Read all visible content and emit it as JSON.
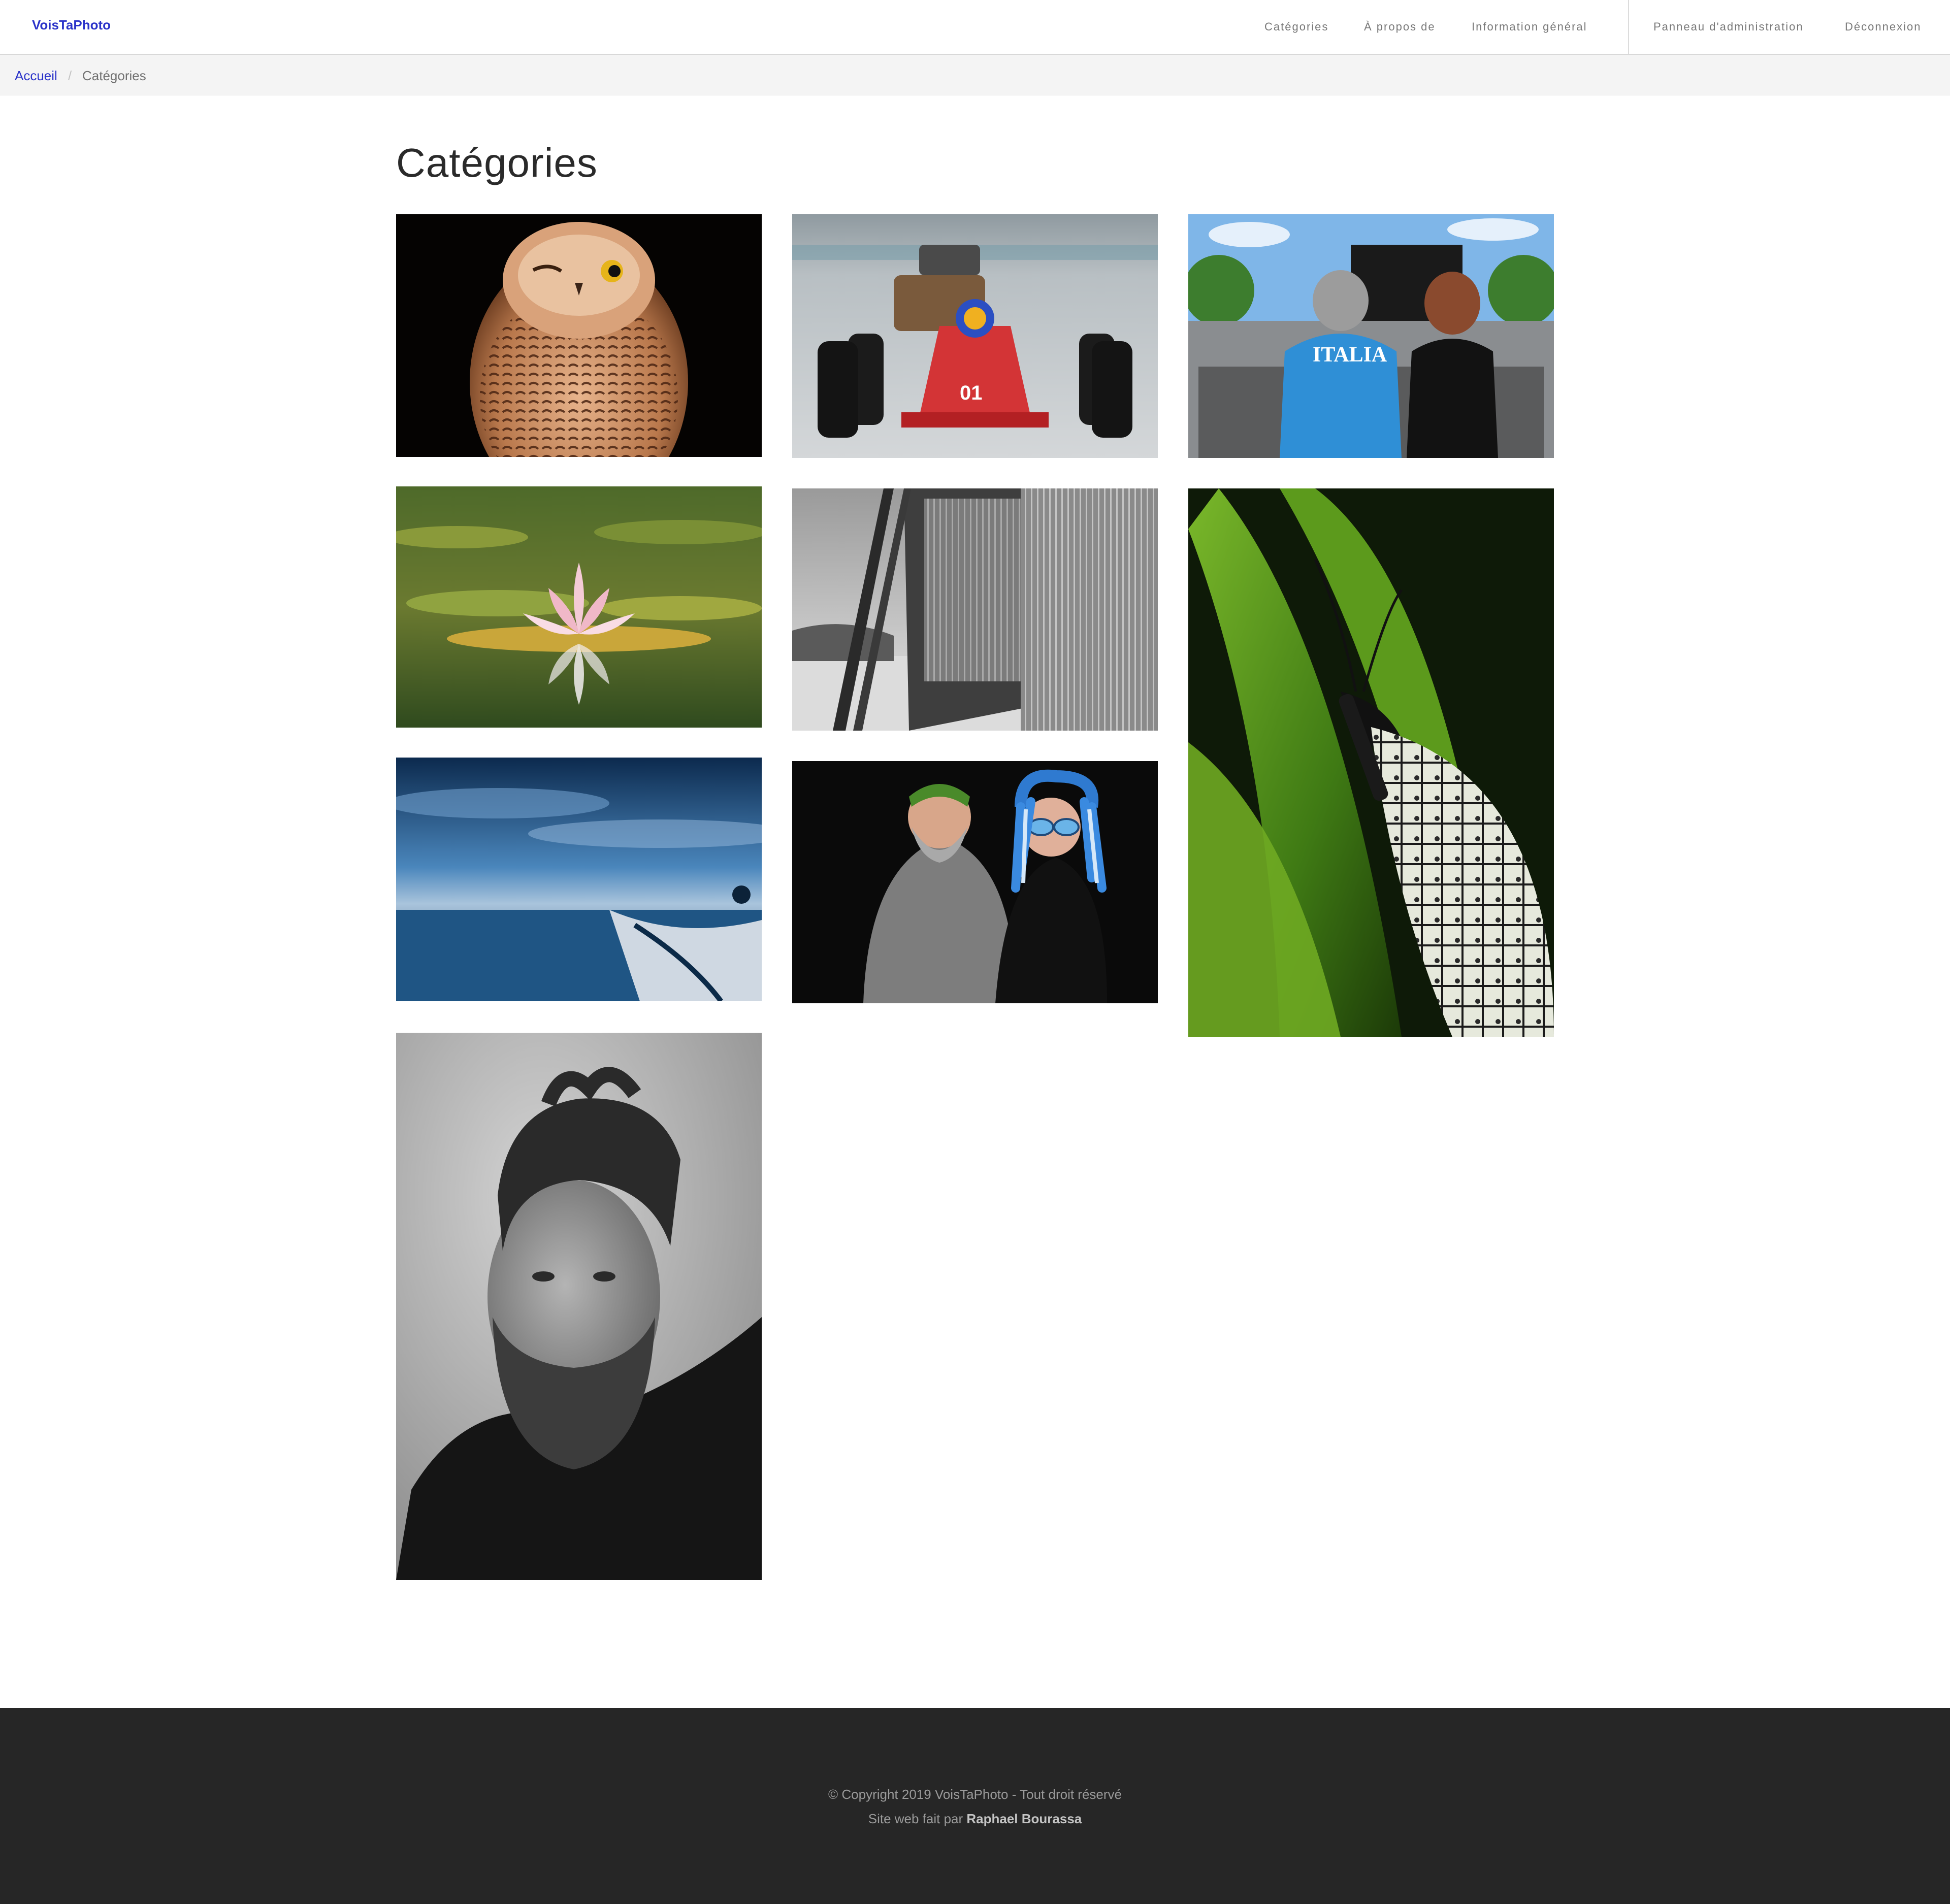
{
  "navbar": {
    "brand": "VoisTaPhoto",
    "items": [
      {
        "label": "Catégories"
      },
      {
        "label": "À propos de"
      },
      {
        "label": "Information général"
      },
      {
        "label": "Panneau d'administration"
      },
      {
        "label": "Déconnexion"
      }
    ]
  },
  "breadcrumb": {
    "home": "Accueil",
    "separator": "/",
    "current": "Catégories"
  },
  "page": {
    "title": "Catégories"
  },
  "gallery": [
    {
      "subject": "snowy owl"
    },
    {
      "subject": "race car"
    },
    {
      "subject": "outdoor concert audience"
    },
    {
      "subject": "water lily"
    },
    {
      "subject": "ice sculpture"
    },
    {
      "subject": "butterfly on leaf"
    },
    {
      "subject": "blue seascape"
    },
    {
      "subject": "couple with costume wigs"
    },
    {
      "subject": "bearded man portrait"
    }
  ],
  "footer": {
    "copyright": "© Copyright 2019 VoisTaPhoto - Tout droit réservé",
    "credit_prefix": "Site web fait par ",
    "credit_name": "Raphael Bourassa"
  },
  "colors": {
    "accent": "#2a32c9",
    "footer_bg": "#262626",
    "breadcrumb_bg": "#f4f4f4"
  }
}
